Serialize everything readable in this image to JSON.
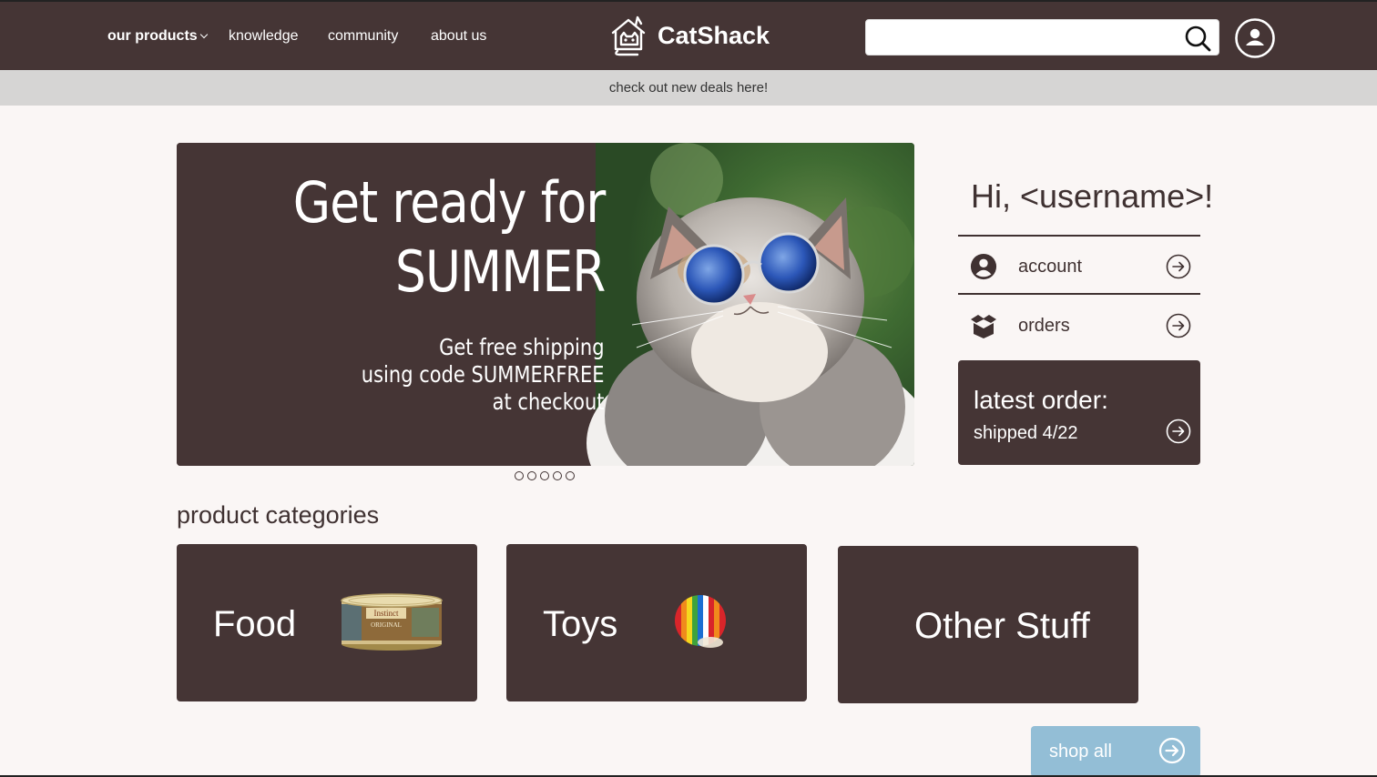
{
  "nav": {
    "items": [
      {
        "label": "our products",
        "has_dropdown": true
      },
      {
        "label": "knowledge"
      },
      {
        "label": "community"
      },
      {
        "label": "about us"
      }
    ],
    "brand": "CatShack",
    "search": {
      "value": "",
      "placeholder": ""
    },
    "icons": {
      "logo": "cat-house-icon",
      "search": "search-icon",
      "profile": "user-circle-icon"
    }
  },
  "promo": {
    "text": "check out new deals here!"
  },
  "hero": {
    "title_line1": "Get ready for",
    "title_line2": "SUMMER",
    "sub_line1": "Get free shipping",
    "sub_line2": "using code SUMMERFREE",
    "sub_line3": "at checkout",
    "slide_count": 5
  },
  "user_panel": {
    "greeting": "Hi, <username>!",
    "items": [
      {
        "label": "account",
        "icon": "user-circle-icon"
      },
      {
        "label": "orders",
        "icon": "open-box-icon"
      }
    ],
    "latest_order": {
      "title": "latest order:",
      "status": "shipped 4/22"
    }
  },
  "categories": {
    "heading": "product categories",
    "items": [
      {
        "label": "Food",
        "image": "cat-food-can"
      },
      {
        "label": "Toys",
        "image": "rainbow-ball"
      },
      {
        "label": "Other Stuff"
      }
    ],
    "food_can_text": {
      "brand": "Instinct",
      "line": "ORIGINAL"
    },
    "shop_all_label": "shop all"
  },
  "colors": {
    "brand_dark": "#453535",
    "promo_bg": "#d6d5d4",
    "page_bg": "#faf6f5",
    "shop_all_bg": "#93bed6"
  }
}
